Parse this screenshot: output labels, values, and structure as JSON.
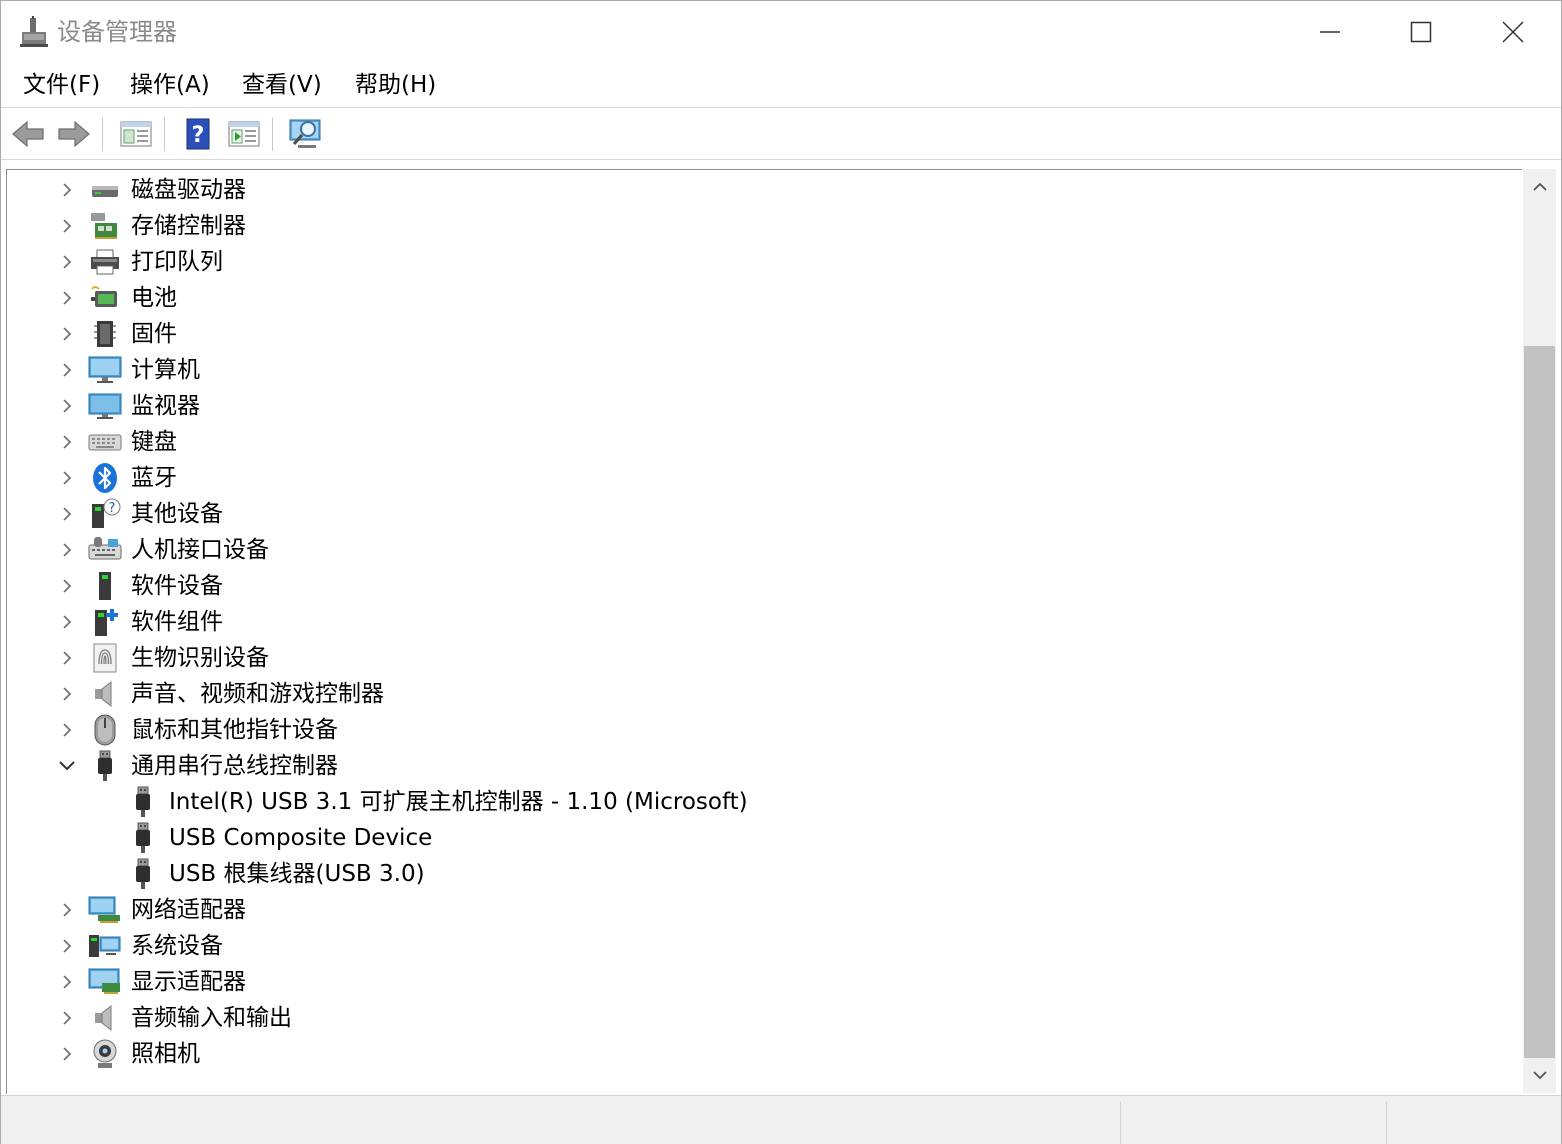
{
  "window": {
    "title": "设备管理器",
    "controls": {
      "minimize": "minimize",
      "maximize": "maximize",
      "close": "close"
    }
  },
  "menu": [
    {
      "label": "文件(F)"
    },
    {
      "label": "操作(A)"
    },
    {
      "label": "查看(V)"
    },
    {
      "label": "帮助(H)"
    }
  ],
  "toolbar": [
    {
      "icon": "back-arrow-icon"
    },
    {
      "icon": "forward-arrow-icon"
    },
    {
      "icon": "properties-icon"
    },
    {
      "icon": "help-icon"
    },
    {
      "icon": "run-icon"
    },
    {
      "icon": "monitor-scan-icon"
    }
  ],
  "tree": {
    "items": [
      {
        "label": "磁盘驱动器",
        "icon": "disk-drive-icon",
        "expanded": false
      },
      {
        "label": "存储控制器",
        "icon": "storage-controller-icon",
        "expanded": false
      },
      {
        "label": "打印队列",
        "icon": "printer-icon",
        "expanded": false
      },
      {
        "label": "电池",
        "icon": "battery-icon",
        "expanded": false
      },
      {
        "label": "固件",
        "icon": "firmware-icon",
        "expanded": false
      },
      {
        "label": "计算机",
        "icon": "computer-icon",
        "expanded": false
      },
      {
        "label": "监视器",
        "icon": "monitor-icon",
        "expanded": false
      },
      {
        "label": "键盘",
        "icon": "keyboard-icon",
        "expanded": false
      },
      {
        "label": "蓝牙",
        "icon": "bluetooth-icon",
        "expanded": false
      },
      {
        "label": "其他设备",
        "icon": "unknown-device-icon",
        "expanded": false
      },
      {
        "label": "人机接口设备",
        "icon": "hid-icon",
        "expanded": false
      },
      {
        "label": "软件设备",
        "icon": "software-device-icon",
        "expanded": false
      },
      {
        "label": "软件组件",
        "icon": "software-component-icon",
        "expanded": false
      },
      {
        "label": "生物识别设备",
        "icon": "fingerprint-icon",
        "expanded": false
      },
      {
        "label": "声音、视频和游戏控制器",
        "icon": "speaker-icon",
        "expanded": false
      },
      {
        "label": "鼠标和其他指针设备",
        "icon": "mouse-icon",
        "expanded": false
      },
      {
        "label": "通用串行总线控制器",
        "icon": "usb-icon",
        "expanded": true,
        "children": [
          {
            "label": "Intel(R) USB 3.1 可扩展主机控制器 - 1.10 (Microsoft)",
            "icon": "usb-icon"
          },
          {
            "label": "USB Composite Device",
            "icon": "usb-icon"
          },
          {
            "label": "USB 根集线器(USB 3.0)",
            "icon": "usb-icon"
          }
        ]
      },
      {
        "label": "网络适配器",
        "icon": "network-adapter-icon",
        "expanded": false
      },
      {
        "label": "系统设备",
        "icon": "system-device-icon",
        "expanded": false
      },
      {
        "label": "显示适配器",
        "icon": "display-adapter-icon",
        "expanded": false
      },
      {
        "label": "音频输入和输出",
        "icon": "speaker-icon",
        "expanded": false
      },
      {
        "label": "照相机",
        "icon": "camera-icon",
        "expanded": false
      }
    ]
  }
}
